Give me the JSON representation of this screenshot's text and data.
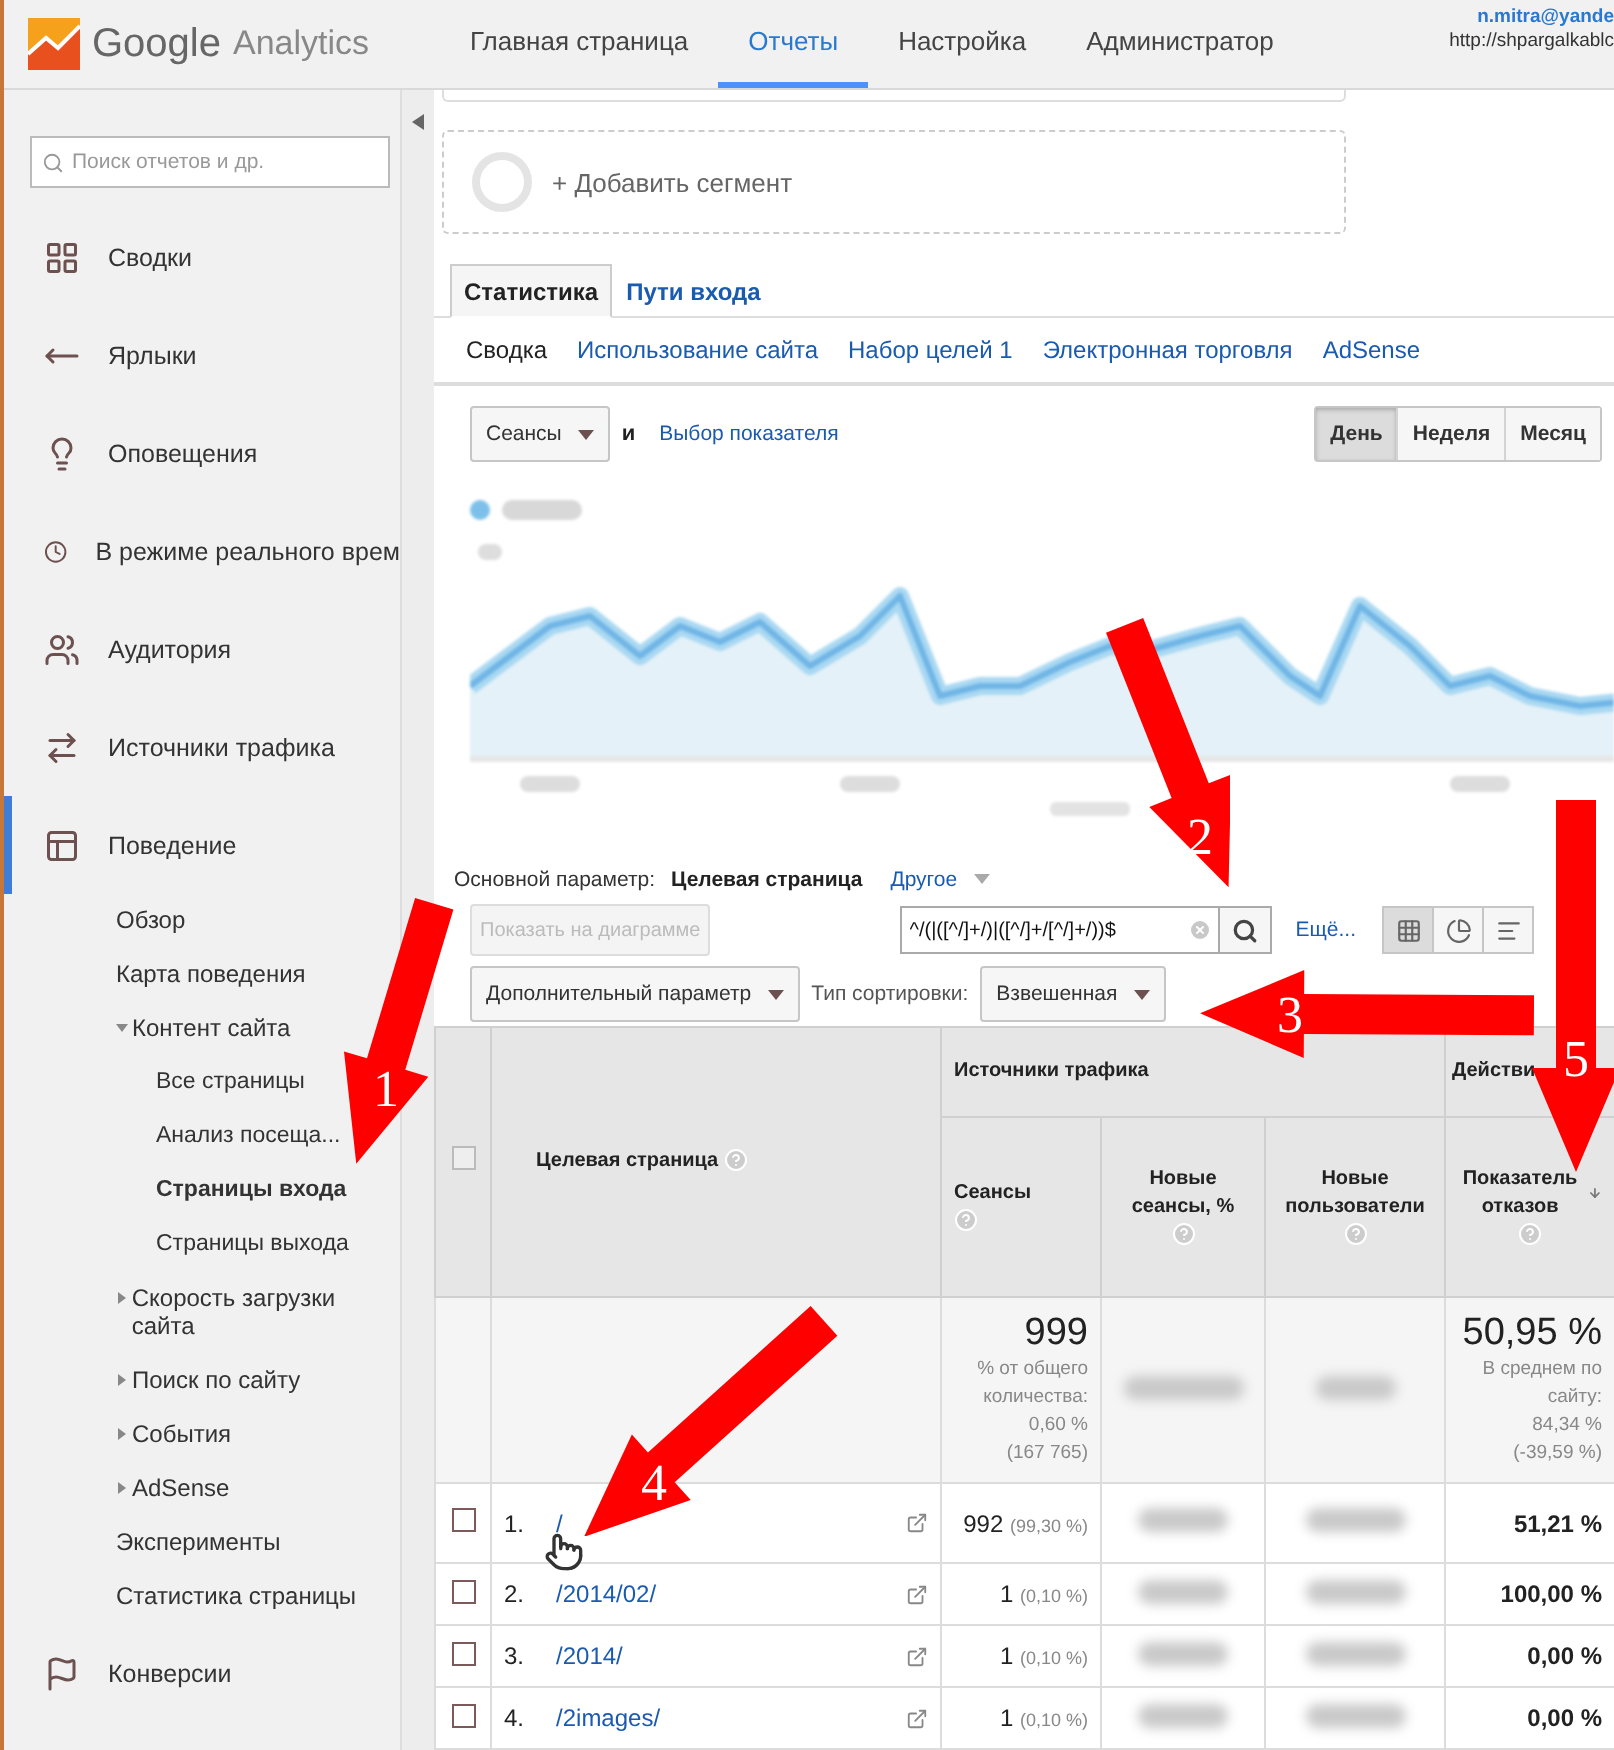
{
  "logo": {
    "brand": "Google",
    "product": "Analytics"
  },
  "nav": [
    {
      "label": "Главная страница",
      "selected": false
    },
    {
      "label": "Отчеты",
      "selected": true
    },
    {
      "label": "Настройка",
      "selected": false
    },
    {
      "label": "Администратор",
      "selected": false
    }
  ],
  "account": {
    "email": "n.mitra@yande",
    "url": "http://shpargalkablc"
  },
  "sidebar": {
    "search_placeholder": "Поиск отчетов и др.",
    "items": [
      {
        "kind": "grid",
        "label": "Сводки",
        "selected": false
      },
      {
        "kind": "shortcut",
        "label": "Ярлыки",
        "selected": false
      },
      {
        "kind": "bulb",
        "label": "Оповещения",
        "selected": false
      },
      {
        "kind": "clock",
        "label": "В режиме реального врем",
        "selected": false
      },
      {
        "kind": "people",
        "label": "Аудитория",
        "selected": false
      },
      {
        "kind": "traffic",
        "label": "Источники трафика",
        "selected": false
      },
      {
        "kind": "layout",
        "label": "Поведение",
        "selected": true,
        "children": [
          {
            "label": "Обзор",
            "selected": false
          },
          {
            "label": "Карта поведения",
            "selected": false
          },
          {
            "label": "Контент сайта",
            "selected": false,
            "expanded": true,
            "children": [
              {
                "label": "Все страницы",
                "selected": false
              },
              {
                "label": "Анализ посеща...",
                "selected": false
              },
              {
                "label": "Страницы входа",
                "selected": true
              },
              {
                "label": "Страницы выхода",
                "selected": false
              }
            ]
          },
          {
            "label": "Скорость загрузки сайта",
            "selected": false,
            "expanded": false
          },
          {
            "label": "Поиск по сайту",
            "selected": false,
            "expanded": false
          },
          {
            "label": "События",
            "selected": false,
            "expanded": false
          },
          {
            "label": "AdSense",
            "selected": false,
            "expanded": false
          },
          {
            "label": "Эксперименты",
            "selected": false
          },
          {
            "label": "Статистика страницы",
            "selected": false
          }
        ]
      },
      {
        "kind": "flag",
        "label": "Конверсии",
        "selected": false
      }
    ]
  },
  "segment": {
    "add_label": "+ Добавить сегмент"
  },
  "tabs": [
    {
      "label": "Статистика",
      "selected": true
    },
    {
      "label": "Пути входа",
      "selected": false
    }
  ],
  "subtabs": [
    {
      "label": "Сводка",
      "selected": true
    },
    {
      "label": "Использование сайта",
      "selected": false
    },
    {
      "label": "Набор целей 1",
      "selected": false
    },
    {
      "label": "Электронная торговля",
      "selected": false
    },
    {
      "label": "AdSense",
      "selected": false
    }
  ],
  "chart_controls": {
    "metric": "Сеансы",
    "conjunction": "и",
    "select_link": "Выбор показателя",
    "periods": [
      {
        "label": "День",
        "selected": true
      },
      {
        "label": "Неделя",
        "selected": false
      },
      {
        "label": "Месяц",
        "selected": false
      }
    ]
  },
  "dimension": {
    "label": "Основной параметр:",
    "value": "Целевая страница",
    "other": "Другое"
  },
  "toolbar": {
    "plot_button": {
      "label": "Показать на диаграмме",
      "disabled": true
    },
    "filter": "^/(|([^/]+/)|([^/]+/[^/]+/))$",
    "more": "Ещё...",
    "views": [
      {
        "kind": "table",
        "selected": true
      },
      {
        "kind": "pie",
        "selected": false
      },
      {
        "kind": "bars",
        "selected": false
      }
    ],
    "secondary": "Дополнительный параметр",
    "sort_label": "Тип сортировки:",
    "sort_value": "Взвешенная"
  },
  "table": {
    "groups": [
      "Источники трафика",
      "Действи"
    ],
    "columns": [
      {
        "label": "Целевая страница"
      },
      {
        "label": "Сеансы"
      },
      {
        "label": "Новые сеансы, %"
      },
      {
        "label": "Новые пользователи"
      },
      {
        "label": "Показатель отказов",
        "sorted": true
      }
    ],
    "select_all_checked": false,
    "totals": {
      "sessions": "999",
      "sessions_note": [
        "% от общего количества:",
        "0,60 %",
        "(167 765)"
      ],
      "bounce": "50,95 %",
      "bounce_note": [
        "В среднем по сайту:",
        "84,34 %",
        "(-39,59 %)"
      ]
    },
    "rows": [
      {
        "index": "1.",
        "page": "/",
        "sessions": "992",
        "share": "(99,30 %)",
        "bounce": "51,21 %",
        "checked": false
      },
      {
        "index": "2.",
        "page": "/2014/02/",
        "sessions": "1",
        "share": "(0,10 %)",
        "bounce": "100,00 %",
        "checked": false
      },
      {
        "index": "3.",
        "page": "/2014/",
        "sessions": "1",
        "share": "(0,10 %)",
        "bounce": "0,00 %",
        "checked": false
      },
      {
        "index": "4.",
        "page": "/2images/",
        "sessions": "1",
        "share": "(0,10 %)",
        "bounce": "0,00 %",
        "checked": false
      }
    ]
  },
  "annotations": [
    {
      "label": "1"
    },
    {
      "label": "2"
    },
    {
      "label": "3"
    },
    {
      "label": "4"
    },
    {
      "label": "5"
    }
  ]
}
